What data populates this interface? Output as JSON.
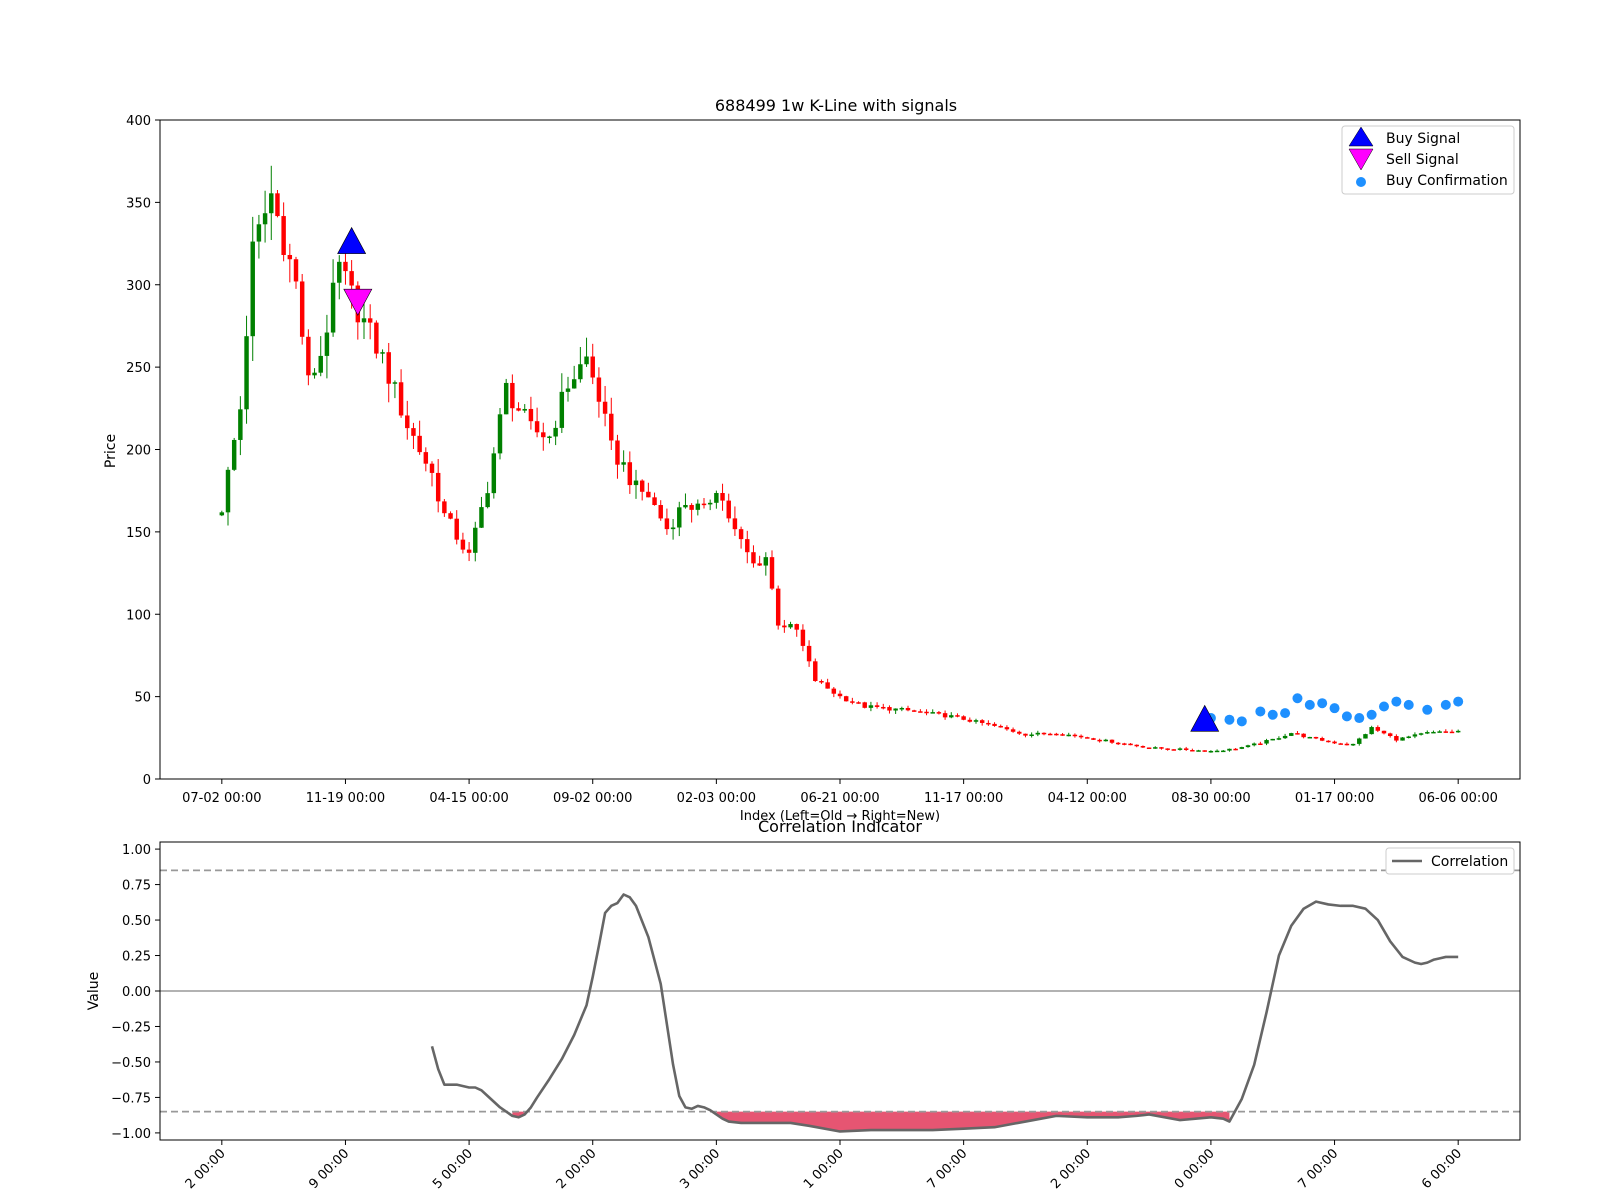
{
  "chart_data": [
    {
      "type": "candlestick",
      "title": "688499 1w K-Line with signals",
      "xlabel": "Index (Left=Old → Right=New)",
      "ylabel": "Price",
      "ylim": [
        0,
        400
      ],
      "yticks": [
        0,
        50,
        100,
        150,
        200,
        250,
        300,
        350,
        400
      ],
      "x_tick_labels": [
        "07-02 00:00",
        "11-19 00:00",
        "04-15 00:00",
        "09-02 00:00",
        "02-03 00:00",
        "06-21 00:00",
        "11-17 00:00",
        "04-12 00:00",
        "08-30 00:00",
        "01-17 00:00",
        "06-06 00:00"
      ],
      "x_tick_index": [
        0,
        20,
        40,
        60,
        80,
        100,
        120,
        140,
        160,
        180,
        200
      ],
      "x_range_index": [
        -10,
        210
      ],
      "close_path_index": [
        0,
        3,
        5,
        8,
        12,
        14,
        16,
        19,
        22,
        26,
        30,
        34,
        36,
        40,
        43,
        46,
        50,
        53,
        56,
        59,
        61,
        63,
        65,
        67,
        69,
        72,
        75,
        78,
        80,
        83,
        86,
        88,
        90,
        93,
        96,
        100,
        104,
        110,
        118,
        124,
        130,
        135,
        140,
        145,
        150,
        155,
        160,
        163,
        166,
        170,
        173,
        176,
        180,
        183,
        186,
        190,
        195,
        200
      ],
      "close_path": [
        165,
        225,
        320,
        355,
        300,
        240,
        258,
        310,
        285,
        255,
        215,
        185,
        160,
        135,
        178,
        237,
        212,
        208,
        240,
        255,
        232,
        200,
        190,
        176,
        172,
        152,
        168,
        162,
        178,
        150,
        130,
        135,
        95,
        90,
        60,
        50,
        44,
        42,
        38,
        33,
        27,
        28,
        25,
        22,
        19,
        18,
        17,
        18,
        20,
        24,
        28,
        25,
        22,
        21,
        31,
        24,
        28,
        29
      ],
      "buy_signals": [
        {
          "index": 21,
          "price": 325
        },
        {
          "index": 159,
          "price": 35
        }
      ],
      "sell_signals": [
        {
          "index": 22,
          "price": 290
        }
      ],
      "buy_confirmation": {
        "x_index": [
          160,
          163,
          165,
          168,
          170,
          172,
          174,
          176,
          178,
          180,
          182,
          184,
          186,
          188,
          190,
          192,
          195,
          198,
          200
        ],
        "y": [
          37,
          36,
          35,
          41,
          39,
          40,
          49,
          45,
          46,
          43,
          38,
          37,
          39,
          44,
          47,
          45,
          42,
          45,
          47
        ]
      },
      "legend": [
        "Buy Signal",
        "Sell Signal",
        "Buy Confirmation"
      ],
      "legend_position": "upper right",
      "colors": {
        "up": "#008000",
        "down": "#ff0000",
        "buy": "#0000ff",
        "sell": "#ff00ff",
        "confirm": "#1e90ff"
      }
    },
    {
      "type": "line",
      "title": "Correlation Indicator",
      "ylabel": "Value",
      "ylim": [
        -1.05,
        1.05
      ],
      "yticks": [
        -1.0,
        -0.75,
        -0.5,
        -0.25,
        0.0,
        0.25,
        0.5,
        0.75,
        1.0
      ],
      "ytick_labels": [
        "−1.00",
        "−0.75",
        "−0.50",
        "−0.25",
        "0.00",
        "0.25",
        "0.50",
        "0.75",
        "1.00"
      ],
      "x_tick_labels": [
        "2 00:00",
        "9 00:00",
        "5 00:00",
        "2 00:00",
        "3 00:00",
        "1 00:00",
        "7 00:00",
        "2 00:00",
        "0 00:00",
        "7 00:00",
        "6 00:00"
      ],
      "x_tick_index": [
        0,
        20,
        40,
        60,
        80,
        100,
        120,
        140,
        160,
        180,
        200
      ],
      "x_range_index": [
        -10,
        210
      ],
      "series": [
        {
          "name": "Correlation",
          "x_index": [
            34,
            35,
            36,
            38,
            40,
            41,
            42,
            43,
            45,
            47,
            48,
            49,
            50,
            51,
            53,
            55,
            57,
            59,
            60,
            61,
            62,
            63,
            64,
            65,
            66,
            67,
            69,
            71,
            73,
            74,
            75,
            76,
            77,
            78,
            79,
            80,
            81,
            82,
            84,
            86,
            88,
            90,
            92,
            95,
            100,
            105,
            110,
            115,
            120,
            125,
            130,
            135,
            140,
            142,
            145,
            148,
            150,
            155,
            160,
            162,
            163,
            165,
            167,
            169,
            171,
            173,
            175,
            177,
            179,
            181,
            183,
            185,
            187,
            189,
            191,
            193,
            194,
            195,
            196,
            197,
            198,
            199,
            200
          ],
          "y": [
            -0.39,
            -0.55,
            -0.66,
            -0.66,
            -0.68,
            -0.68,
            -0.7,
            -0.74,
            -0.82,
            -0.88,
            -0.89,
            -0.87,
            -0.82,
            -0.75,
            -0.62,
            -0.48,
            -0.31,
            -0.1,
            0.1,
            0.32,
            0.55,
            0.6,
            0.62,
            0.68,
            0.66,
            0.6,
            0.38,
            0.05,
            -0.52,
            -0.74,
            -0.82,
            -0.83,
            -0.81,
            -0.82,
            -0.84,
            -0.87,
            -0.9,
            -0.92,
            -0.93,
            -0.93,
            -0.93,
            -0.93,
            -0.93,
            -0.95,
            -0.99,
            -0.98,
            -0.98,
            -0.98,
            -0.97,
            -0.96,
            -0.92,
            -0.88,
            -0.89,
            -0.89,
            -0.89,
            -0.88,
            -0.87,
            -0.91,
            -0.89,
            -0.9,
            -0.92,
            -0.76,
            -0.52,
            -0.15,
            0.25,
            0.46,
            0.58,
            0.63,
            0.61,
            0.6,
            0.6,
            0.58,
            0.5,
            0.35,
            0.24,
            0.2,
            0.19,
            0.2,
            0.22,
            0.23,
            0.24,
            0.24,
            0.24
          ]
        }
      ],
      "reference_lines": [
        0.85,
        -0.85,
        0.0
      ],
      "fill_below": -0.85,
      "legend_position": "upper right",
      "colors": {
        "line": "#666666",
        "fill": "#dc143c",
        "ref": "#999999"
      }
    }
  ]
}
